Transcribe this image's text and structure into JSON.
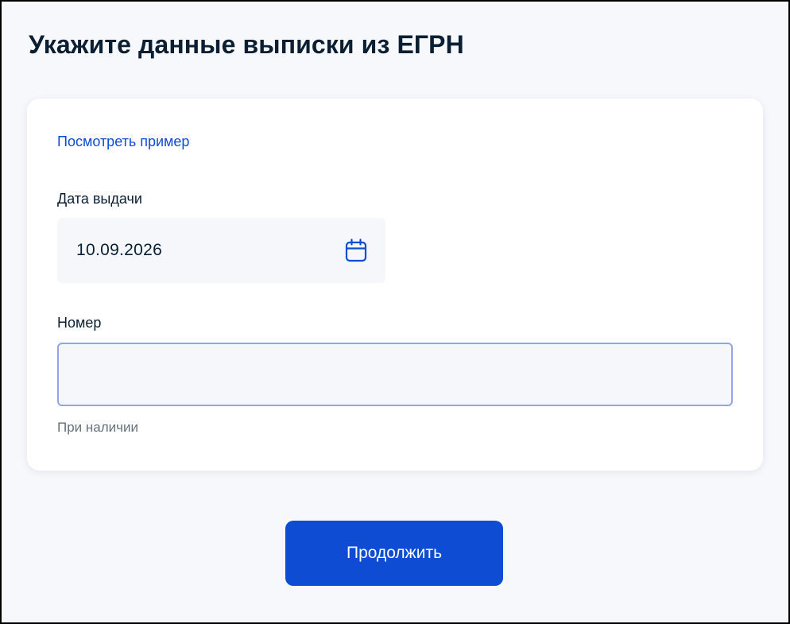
{
  "page": {
    "title": "Укажите данные выписки из ЕГРН"
  },
  "form": {
    "example_link": "Посмотреть пример",
    "date": {
      "label": "Дата выдачи",
      "value": "10.09.2026",
      "icon": "calendar-icon"
    },
    "number": {
      "label": "Номер",
      "value": "",
      "hint": "При наличии"
    }
  },
  "actions": {
    "continue_label": "Продолжить"
  },
  "colors": {
    "accent": "#0d4cd3",
    "title_text": "#0b1f33",
    "hint_text": "#66727f",
    "field_background": "#f5f7fa",
    "focus_border": "#8fa8e5",
    "page_background": "#f6f8fc"
  }
}
